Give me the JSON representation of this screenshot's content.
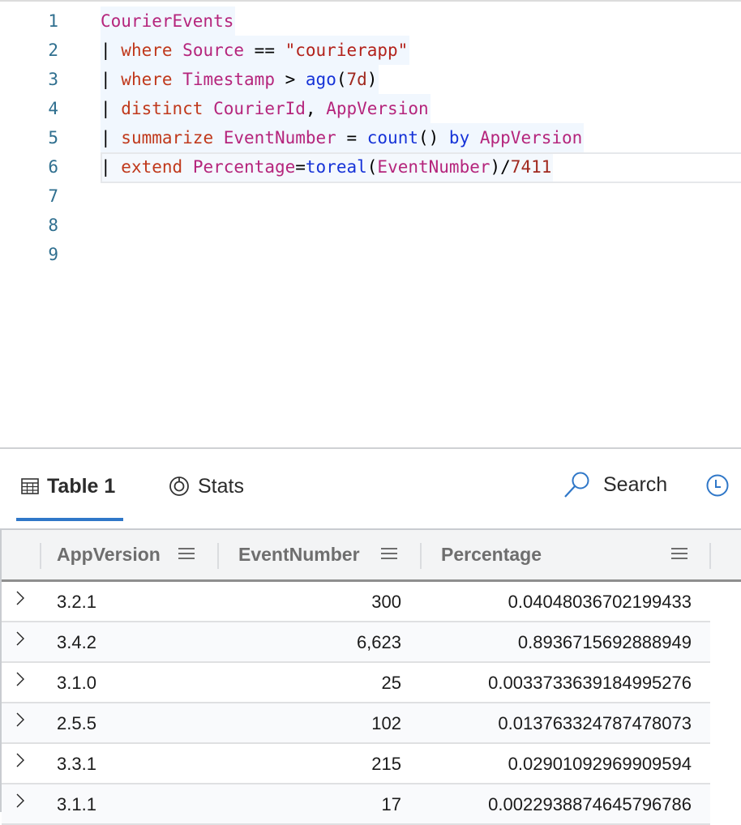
{
  "editor": {
    "line_numbers": [
      "1",
      "2",
      "3",
      "4",
      "5",
      "6",
      "7",
      "8",
      "9"
    ],
    "lines": [
      [
        {
          "t": "table",
          "v": "CourierEvents"
        }
      ],
      [
        {
          "t": "pipe",
          "v": "| "
        },
        {
          "t": "kw",
          "v": "where"
        },
        {
          "t": "op",
          "v": " "
        },
        {
          "t": "ident",
          "v": "Source"
        },
        {
          "t": "op",
          "v": " == "
        },
        {
          "t": "str",
          "v": "\"courierapp\""
        }
      ],
      [
        {
          "t": "pipe",
          "v": "| "
        },
        {
          "t": "kw",
          "v": "where"
        },
        {
          "t": "op",
          "v": " "
        },
        {
          "t": "ident",
          "v": "Timestamp"
        },
        {
          "t": "op",
          "v": " > "
        },
        {
          "t": "fn",
          "v": "ago"
        },
        {
          "t": "op",
          "v": "("
        },
        {
          "t": "num",
          "v": "7d"
        },
        {
          "t": "op",
          "v": ")"
        }
      ],
      [
        {
          "t": "pipe",
          "v": "| "
        },
        {
          "t": "kw",
          "v": "distinct"
        },
        {
          "t": "op",
          "v": " "
        },
        {
          "t": "ident",
          "v": "CourierId"
        },
        {
          "t": "op",
          "v": ", "
        },
        {
          "t": "ident",
          "v": "AppVersion"
        }
      ],
      [
        {
          "t": "pipe",
          "v": "| "
        },
        {
          "t": "kw",
          "v": "summarize"
        },
        {
          "t": "op",
          "v": " "
        },
        {
          "t": "ident",
          "v": "EventNumber"
        },
        {
          "t": "op",
          "v": " = "
        },
        {
          "t": "fn",
          "v": "count"
        },
        {
          "t": "op",
          "v": "() "
        },
        {
          "t": "fn",
          "v": "by"
        },
        {
          "t": "op",
          "v": " "
        },
        {
          "t": "ident",
          "v": "AppVersion"
        }
      ],
      [
        {
          "t": "pipe",
          "v": "| "
        },
        {
          "t": "kw",
          "v": "extend"
        },
        {
          "t": "op",
          "v": " "
        },
        {
          "t": "ident",
          "v": "Percentage"
        },
        {
          "t": "op",
          "v": "="
        },
        {
          "t": "fn",
          "v": "toreal"
        },
        {
          "t": "op",
          "v": "("
        },
        {
          "t": "ident",
          "v": "EventNumber"
        },
        {
          "t": "op",
          "v": ")/"
        },
        {
          "t": "num",
          "v": "7411"
        }
      ]
    ],
    "current_line": 6
  },
  "results": {
    "tabs": [
      {
        "label": "Table 1",
        "icon": "table-icon",
        "active": true
      },
      {
        "label": "Stats",
        "icon": "stats-icon",
        "active": false
      }
    ],
    "search_label": "Search",
    "accent_color": "#2f77c8",
    "columns": [
      {
        "label": "AppVersion"
      },
      {
        "label": "EventNumber"
      },
      {
        "label": "Percentage"
      }
    ],
    "rows": [
      {
        "AppVersion": "3.2.1",
        "EventNumber": "300",
        "Percentage": "0.04048036702199433"
      },
      {
        "AppVersion": "3.4.2",
        "EventNumber": "6,623",
        "Percentage": "0.8936715692888949"
      },
      {
        "AppVersion": "3.1.0",
        "EventNumber": "25",
        "Percentage": "0.0033733639184995276"
      },
      {
        "AppVersion": "2.5.5",
        "EventNumber": "102",
        "Percentage": "0.013763324787478073"
      },
      {
        "AppVersion": "3.3.1",
        "EventNumber": "215",
        "Percentage": "0.02901092969909594"
      },
      {
        "AppVersion": "3.1.1",
        "EventNumber": "17",
        "Percentage": "0.0022938874645796786"
      }
    ]
  }
}
